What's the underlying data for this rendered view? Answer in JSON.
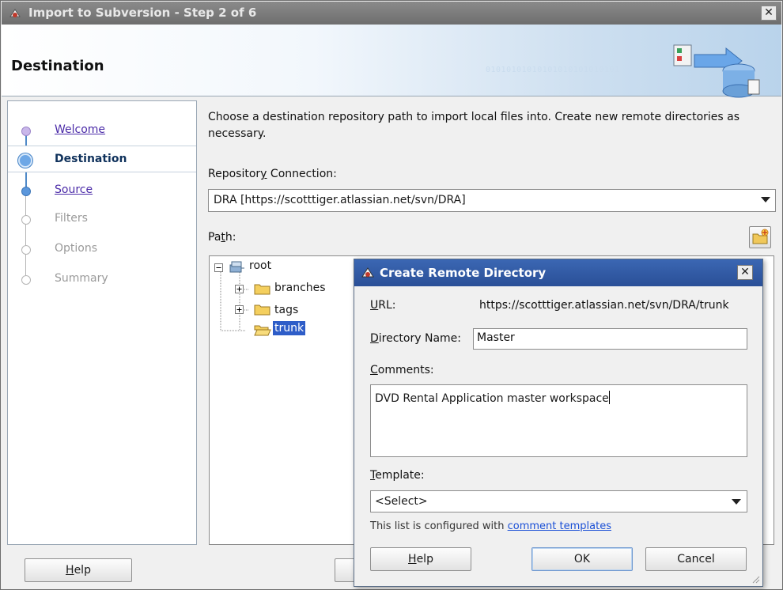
{
  "window": {
    "title": "Import to Subversion - Step 2 of 6",
    "header_title": "Destination",
    "binary_decoration": "01010101010101010101010101"
  },
  "steps": [
    {
      "label": "Welcome",
      "state": "link"
    },
    {
      "label": "Destination",
      "state": "active"
    },
    {
      "label": "Source",
      "state": "link"
    },
    {
      "label": "Filters",
      "state": "future"
    },
    {
      "label": "Options",
      "state": "future"
    },
    {
      "label": "Summary",
      "state": "future"
    }
  ],
  "main": {
    "description": "Choose a destination repository path to import local files into. Create new remote directories as necessary.",
    "repo_label_pre": "Repositor",
    "repo_label_mnemonic": "y",
    "repo_label_post": " Connection:",
    "repo_value": "DRA [https://scotttiger.atlassian.net/svn/DRA]",
    "path_label_pre": "Pa",
    "path_label_mnemonic": "t",
    "path_label_post": "h:"
  },
  "tree": {
    "root": "root",
    "children": [
      "branches",
      "tags",
      "trunk"
    ],
    "selected": "trunk"
  },
  "footer": {
    "help_label": "Help",
    "help_mnemonic": "H",
    "help_rest": "elp"
  },
  "dialog": {
    "title": "Create Remote Directory",
    "url_label": "URL:",
    "url_mnemonic": "U",
    "url_rest": "RL:",
    "url_value": "https://scotttiger.atlassian.net/svn/DRA/trunk",
    "dirname_mnemonic": "D",
    "dirname_rest": "irectory Name:",
    "dirname_value": "Master",
    "comments_mnemonic": "C",
    "comments_rest": "omments:",
    "comments_value": "DVD Rental Application master workspace",
    "template_mnemonic": "T",
    "template_rest": "emplate:",
    "template_value": "<Select>",
    "template_note": "This list is configured with ",
    "template_link": "comment templates",
    "help_mnemonic": "H",
    "help_rest": "elp",
    "ok_label": "OK",
    "cancel_label": "Cancel"
  },
  "colors": {
    "accent": "#2e5dc8",
    "link": "#1a4fd6",
    "dialog_title": "#2a4f97"
  }
}
